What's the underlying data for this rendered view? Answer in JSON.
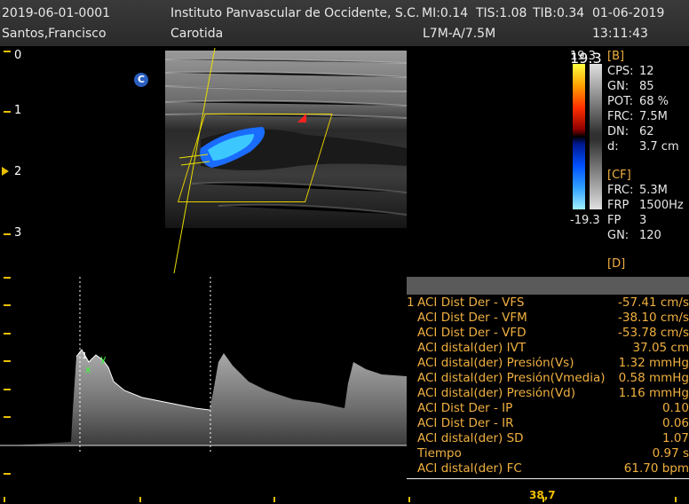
{
  "header": {
    "exam_id": "2019-06-01-0001",
    "institution": "Instituto Panvascular de Occidente, S.C.",
    "mi": "MI:0.14",
    "tis": "TIS:1.08",
    "tib": "TIB:0.34",
    "date": "01-06-2019",
    "patient": "Santos,Francisco",
    "study": "Carotida",
    "probe": "L7M-A/7.5M",
    "time": "13:11:43"
  },
  "depth_scale": [
    "0",
    "1",
    "2",
    "3"
  ],
  "image_marker": "C",
  "color_bar": {
    "top": "19.3",
    "bottom": "-19.3"
  },
  "b_params": {
    "title": "[B]",
    "rows": [
      {
        "label": "CPS:",
        "value": "12"
      },
      {
        "label": "GN:",
        "value": "85"
      },
      {
        "label": "POT:",
        "value": "68 %"
      },
      {
        "label": "FRC:",
        "value": "7.5M"
      },
      {
        "label": "DN:",
        "value": "62"
      },
      {
        "label": "d:",
        "value": "3.7 cm"
      }
    ]
  },
  "cf_params": {
    "title": "[CF]",
    "rows": [
      {
        "label": "FRC:",
        "value": "5.3M"
      },
      {
        "label": "FRP",
        "value": "1500Hz"
      },
      {
        "label": "FP",
        "value": "3"
      },
      {
        "label": "GN:",
        "value": "120"
      }
    ]
  },
  "d_params": {
    "title": "[D]"
  },
  "spectral_markers": {
    "a": "x",
    "b": "y",
    "c": "1"
  },
  "measurements": [
    {
      "index": "1",
      "label": "ACI Dist Der - VFS",
      "value": "-57.41 cm/s"
    },
    {
      "index": "",
      "label": "ACI Dist Der - VFM",
      "value": "-38.10 cm/s"
    },
    {
      "index": "",
      "label": "ACI Dist Der - VFD",
      "value": "-53.78 cm/s"
    },
    {
      "index": "",
      "label": "ACI distal(der) IVT",
      "value": "37.05 cm"
    },
    {
      "index": "",
      "label": "ACI distal(der) Presión(Vs)",
      "value": "1.32 mmHg"
    },
    {
      "index": "",
      "label": "ACI distal(der) Presión(Vmedia)",
      "value": "0.58 mmHg"
    },
    {
      "index": "",
      "label": "ACI distal(der) Presión(Vd)",
      "value": "1.16 mmHg"
    },
    {
      "index": "",
      "label": "ACI Dist Der - IP",
      "value": "0.10"
    },
    {
      "index": "",
      "label": "ACI Dist Der - IR",
      "value": "0.06"
    },
    {
      "index": "",
      "label": "ACI distal(der) SD",
      "value": "1.07"
    },
    {
      "index": "",
      "label": "Tiempo",
      "value": "0.97 s"
    },
    {
      "index": "",
      "label": "ACI distal(der) FC",
      "value": "61.70 bpm"
    }
  ],
  "bottom_value": "38,7",
  "colors": {
    "accent": "#f0b040",
    "tick": "#e8c000",
    "caliper": "#ffff40"
  }
}
